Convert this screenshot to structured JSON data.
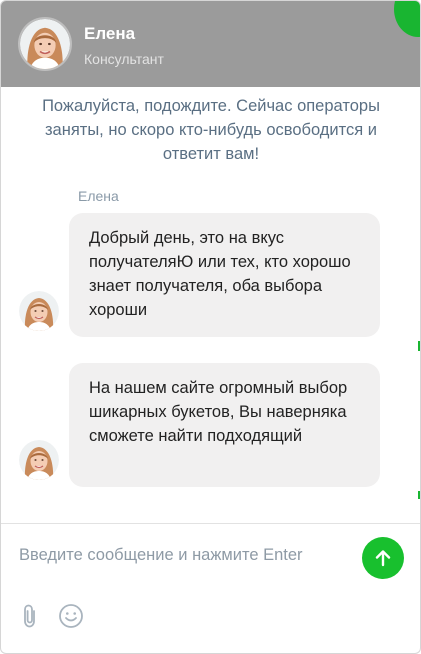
{
  "header": {
    "name": "Елена",
    "role": "Консультант",
    "background": "#9b9b9b",
    "accent": "#19b531"
  },
  "notice": "Пожалуйста, подождите. Сейчас операторы заняты, но скоро кто-нибудь освободится и ответит вам!",
  "messages": [
    {
      "sender": "Елена",
      "text": "Добрый день, это на вкус получателяЮ или тех, кто хорошо знает получателя, оба выбора хороши"
    },
    {
      "text": "На нашем сайте огромный выбор шикарных букетов, Вы наверняка сможете найти подходящий"
    }
  ],
  "composer": {
    "placeholder": "Введите сообщение и нажмите Enter",
    "send_icon": "arrow-up-icon",
    "send_color": "#18c02e",
    "attach_icon": "paperclip-icon",
    "emoji_icon": "smile-icon"
  }
}
